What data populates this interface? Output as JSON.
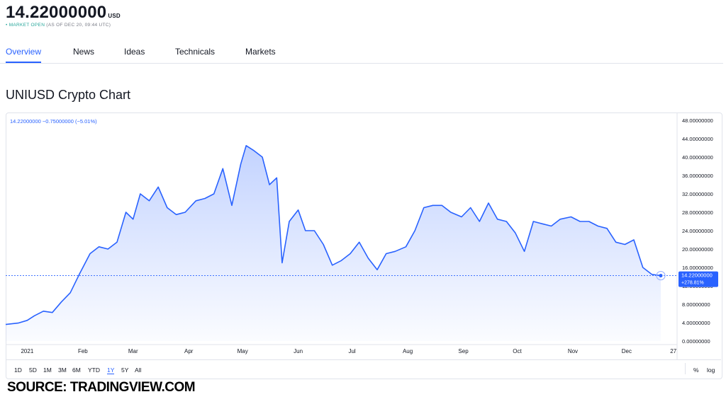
{
  "header": {
    "price": "14.22000000",
    "currency": "USD",
    "status_dot": "•",
    "market_status": "MARKET OPEN",
    "as_of": "(AS OF DEC 20, 09:44 UTC)"
  },
  "tabs": [
    "Overview",
    "News",
    "Ideas",
    "Technicals",
    "Markets"
  ],
  "chart_title": "UNIUSD Crypto Chart",
  "legend": "14.22000000 −0.75000000 (−5.01%)",
  "last_price_label": "14.22000000",
  "change_label": "+278.81%",
  "ranges": [
    "1D",
    "5D",
    "1M",
    "3M",
    "6M",
    "YTD",
    "1Y",
    "5Y",
    "All"
  ],
  "active_range": "1Y",
  "right_tools": {
    "percent": "%",
    "log": "log"
  },
  "source": "SOURCE: TRADINGVIEW.COM",
  "colors": {
    "line": "#2962ff",
    "accent": "#2962ff",
    "market_open": "#26a69a",
    "price_label_bg": "#2962ff"
  },
  "chart_data": {
    "type": "area",
    "title": "UNIUSD Crypto Chart",
    "xlabel": "",
    "ylabel": "",
    "ylim": [
      0,
      48
    ],
    "y_ticks": [
      "48.00000000",
      "44.00000000",
      "40.00000000",
      "36.00000000",
      "32.00000000",
      "28.00000000",
      "24.00000000",
      "20.00000000",
      "16.00000000",
      "12.00000000",
      "8.00000000",
      "4.00000000",
      "0.00000000"
    ],
    "x_ticks": [
      "2021",
      "Feb",
      "Mar",
      "Apr",
      "May",
      "Jun",
      "Jul",
      "Aug",
      "Sep",
      "Oct",
      "Nov",
      "Dec",
      "27"
    ],
    "grid": false,
    "series": [
      {
        "x": [
          "2020-12-20",
          "2020-12-27",
          "2021-01-01",
          "2021-01-05",
          "2021-01-10",
          "2021-01-15",
          "2021-01-20",
          "2021-01-25",
          "2021-01-30",
          "2021-02-05",
          "2021-02-10",
          "2021-02-15",
          "2021-02-20",
          "2021-02-25",
          "2021-03-01",
          "2021-03-05",
          "2021-03-10",
          "2021-03-15",
          "2021-03-20",
          "2021-03-25",
          "2021-03-30",
          "2021-04-05",
          "2021-04-10",
          "2021-04-15",
          "2021-04-20",
          "2021-04-25",
          "2021-04-30",
          "2021-05-03",
          "2021-05-07",
          "2021-05-12",
          "2021-05-16",
          "2021-05-20",
          "2021-05-23",
          "2021-05-27",
          "2021-06-01",
          "2021-06-05",
          "2021-06-10",
          "2021-06-15",
          "2021-06-20",
          "2021-06-25",
          "2021-06-30",
          "2021-07-05",
          "2021-07-10",
          "2021-07-15",
          "2021-07-20",
          "2021-07-25",
          "2021-07-31",
          "2021-08-05",
          "2021-08-10",
          "2021-08-15",
          "2021-08-20",
          "2021-08-25",
          "2021-08-31",
          "2021-09-05",
          "2021-09-10",
          "2021-09-15",
          "2021-09-20",
          "2021-09-25",
          "2021-09-30",
          "2021-10-05",
          "2021-10-10",
          "2021-10-15",
          "2021-10-20",
          "2021-10-25",
          "2021-10-31",
          "2021-11-05",
          "2021-11-10",
          "2021-11-15",
          "2021-11-20",
          "2021-11-25",
          "2021-11-30",
          "2021-12-05",
          "2021-12-10",
          "2021-12-15",
          "2021-12-20"
        ],
        "values": [
          3.6,
          3.9,
          4.5,
          5.5,
          6.5,
          6.2,
          8.5,
          10.5,
          14.5,
          19,
          20.5,
          20,
          21.5,
          28,
          26.5,
          32,
          30.5,
          33.5,
          29,
          27.5,
          28,
          30.5,
          31,
          32,
          37.5,
          29.5,
          38.5,
          42.5,
          41.5,
          40,
          34,
          35.5,
          17,
          26,
          28.5,
          24,
          24,
          21,
          16.5,
          17.5,
          19,
          21.5,
          18,
          15.5,
          19,
          19.5,
          20.5,
          24,
          29,
          29.5,
          29.5,
          28,
          27,
          29,
          26,
          30,
          26.5,
          26,
          23.5,
          19.5,
          26,
          25.5,
          25,
          26.5,
          27,
          26,
          26,
          25,
          24.5,
          21.5,
          21,
          22,
          16,
          14.5,
          14.22
        ]
      }
    ]
  }
}
